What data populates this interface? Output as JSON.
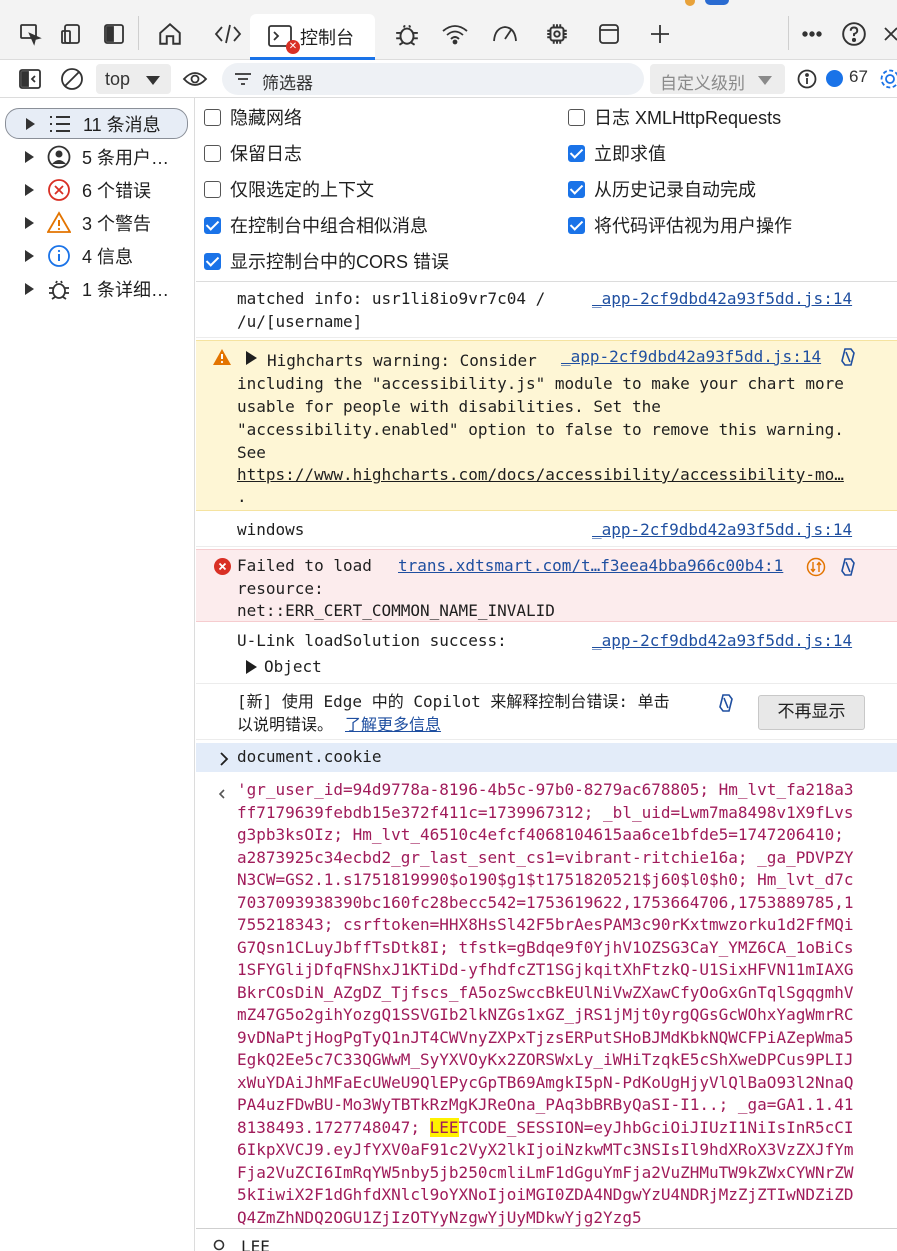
{
  "tabs": {
    "console_label": "控制台",
    "console_error_mark": "✕"
  },
  "toolbar": {
    "context_value": "top",
    "filter_label": "筛选器",
    "levels_label": "自定义级别",
    "issue_count": "67"
  },
  "sidebar": {
    "items": [
      {
        "label": "11 条消息",
        "icon": "list-icon"
      },
      {
        "label": "5 条用户…",
        "icon": "user-icon"
      },
      {
        "label": "6 个错误",
        "icon": "error-icon"
      },
      {
        "label": "3 个警告",
        "icon": "warning-icon"
      },
      {
        "label": "4 信息",
        "icon": "info-icon"
      },
      {
        "label": "1 条详细…",
        "icon": "bug-icon"
      }
    ]
  },
  "settings": {
    "left": [
      {
        "label": "隐藏网络",
        "checked": false
      },
      {
        "label": "保留日志",
        "checked": false
      },
      {
        "label": "仅限选定的上下文",
        "checked": false
      },
      {
        "label": "在控制台中组合相似消息",
        "checked": true
      },
      {
        "label": "显示控制台中的CORS 错误",
        "checked": true
      }
    ],
    "right": [
      {
        "label": "日志 XMLHttpRequests",
        "checked": false
      },
      {
        "label": "立即求值",
        "checked": true
      },
      {
        "label": "从历史记录自动完成",
        "checked": true
      },
      {
        "label": "将代码评估视为用户操作",
        "checked": true
      }
    ]
  },
  "console": {
    "m1_line1": "matched info: usr1li8io9vr7c04 /",
    "m1_line2": "/u/[username]",
    "m1_src": "_app-2cf9dbd42a93f5dd.js:14",
    "warn_first": "Highcharts warning: Consider",
    "warn_src": "_app-2cf9dbd42a93f5dd.js:14",
    "warn_l2": "including the \"accessibility.js\" module to make your chart more",
    "warn_l3": "usable for people with disabilities. Set the",
    "warn_l4": "\"accessibility.enabled\" option to false to remove this warning.",
    "warn_l5": "See",
    "warn_link": "https://www.highcharts.com/docs/accessibility/accessibility-mo…",
    "warn_l7": ".",
    "m3_text": "windows",
    "m3_src": "_app-2cf9dbd42a93f5dd.js:14",
    "err_l1": "Failed to load",
    "err_src": "trans.xdtsmart.com/t…f3eea4bba966c00b4:1",
    "err_l2": "resource:",
    "err_l3": "net::ERR_CERT_COMMON_NAME_INVALID",
    "m5_text": "U-Link loadSolution success:",
    "m5_src": "_app-2cf9dbd42a93f5dd.js:14",
    "m5_obj": "Object",
    "copilot_l1": "[新] 使用 Edge 中的 Copilot 来解释控制台错误: 单击",
    "copilot_l2": "以说明错误。",
    "copilot_link": "了解更多信息",
    "copilot_btn": "不再显示",
    "input": "document.cookie",
    "result_before": "'gr_user_id=94d9778a-8196-4b5c-97b0-8279ac678805; Hm_lvt_fa218a3ff7179639febdb15e372f411c=1739967312; _bl_uid=Lwm7ma8498v1X9fLvsg3pb3ksOIz; Hm_lvt_46510c4efcf4068104615aa6ce1bfde5=1747206410; a2873925c34ecbd2_gr_last_sent_cs1=vibrant-ritchie16a; _ga_PDVPZYN3CW=GS2.1.s1751819990$o190$g1$t1751820521$j60$l0$h0; Hm_lvt_d7c7037093938390bc160fc28becc542=1753619622,1753664706,1753889785,1755218343; csrftoken=HHX8HsSl42F5brAesPAM3c90rKxtmwzorku1d2FfMQiG7Qsn1CLuyJbffTsDtk8I; tfstk=gBdqe9f0YjhV1OZSG3CaY_YMZ6CA_1oBiCs1SFYGlijDfqFNShxJ1KTiDd-yfhdfcZT1SGjkqitXhFtzkQ-U1SixHFVN11mIAXGBkrCOsDiN_AZgDZ_Tjfscs_fA5ozSwccBkEUlNiVwZXawCfyOoGxGnTqlSgqgmhVmZ47G5o2gihYozgQ1SSVGIb2lkNZGs1xGZ_jRS1jMjt0yrgQGsGcWOhxYagWmrRC9vDNaPtjHogPgTyQ1nJT4CWVnyZXPxTjzsERPutSHoBJMdKbkNQWCFPiAZepWma5EgkQ2Ee5c7C33QGWwM_SyYXVOyKx2ZORSWxLy_iWHiTzqkE5cShXweDPCus9PLIJxWuYDAiJhMFaEcUWeU9QlEPycGpTB69AmgkI5pN-PdKoUgHjyVlQlBaO93l2NnaQPA4uzFDwBU-Mo3WyTBTkRzMgKJReOna_PAq3bBRByQaSI-I1..; _ga=GA1.1.418138493.1727748047; ",
    "result_hl": "LEE",
    "result_after": "TCODE_SESSION=eyJhbGciOiJIUzI1NiIsInR5cCI6IkpXVCJ9.eyJfYXV0aF91c2VyX2lkIjoiNzkwMTc3NSIsIl9hdXRoX3VzZXJfYmFja2VuZCI6ImRqYW5nby5jb250cmliLmF1dGguYmFja2VuZHMuTW9kZWxCYWNrZW5kIiwiX2F1dGhfdXNlcl9oYXNoIjoiMGI0ZDA4NDgwYzU4NDRjMzZjZTIwNDZiZDQ4ZmZhNDQ2OGU1ZjIzOTYyNzgwYjUyMDkwYjg2Yzg5"
  },
  "search": {
    "query": "LEE"
  }
}
